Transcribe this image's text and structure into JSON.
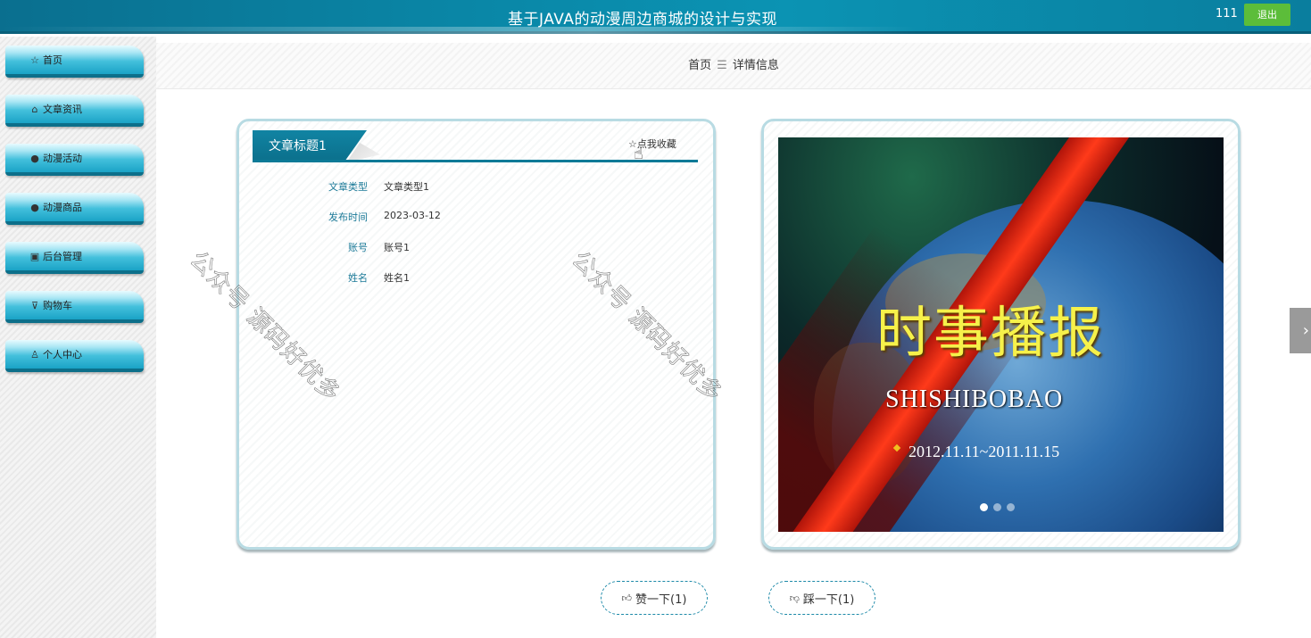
{
  "header": {
    "title": "基于JAVA的动漫周边商城的设计与实现",
    "username": "111",
    "logout_label": "退出"
  },
  "sidebar": {
    "items": [
      {
        "label": "首页",
        "icon": "star-icon"
      },
      {
        "label": "文章资讯",
        "icon": "bag-icon"
      },
      {
        "label": "动漫活动",
        "icon": "alert-icon"
      },
      {
        "label": "动漫商品",
        "icon": "help-icon"
      },
      {
        "label": "后台管理",
        "icon": "gift-icon"
      },
      {
        "label": "购物车",
        "icon": "cart-icon"
      },
      {
        "label": "个人中心",
        "icon": "user-icon"
      }
    ]
  },
  "breadcrumb": {
    "home": "首页",
    "separator": "☰",
    "current": "详情信息"
  },
  "article": {
    "title": "文章标题1",
    "favorite_label": "☆点我收藏",
    "fields": [
      {
        "label": "文章类型",
        "value": "文章类型1"
      },
      {
        "label": "发布时间",
        "value": "2023-03-12"
      },
      {
        "label": "账号",
        "value": "账号1"
      },
      {
        "label": "姓名",
        "value": "姓名1"
      }
    ]
  },
  "banner": {
    "headline": "时事播报",
    "subtitle": "SHISHIBOBAO",
    "date_range": "2012.11.11~2011.11.15",
    "slides_total": 3,
    "active_slide": 1
  },
  "actions": {
    "like_label": "赞一下(1)",
    "dislike_label": "踩一下(1)"
  },
  "watermark": {
    "text": "公众号 源码好优多"
  },
  "colors": {
    "header": "#0a86a6",
    "accent": "#0b7a97",
    "logout": "#5cbd3a"
  }
}
